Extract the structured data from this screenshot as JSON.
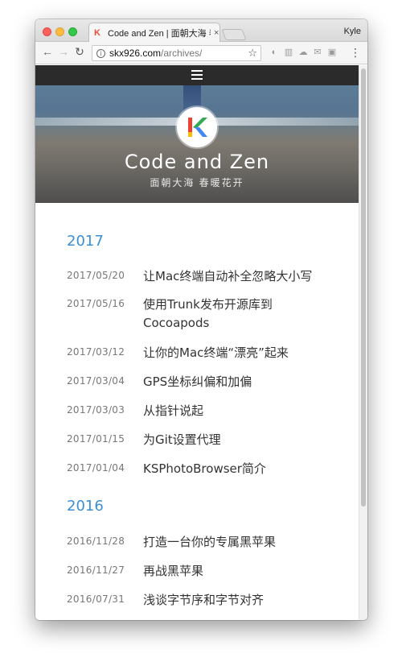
{
  "browser": {
    "tab_title": "Code and Zen | 面朝大海 春暖花开",
    "tab_close": "×",
    "profile_name": "Kyle",
    "url_host": "skx926.com",
    "url_path": "/archives/"
  },
  "site": {
    "title": "Code and Zen",
    "subtitle": "面朝大海 春暖花开",
    "logo_letter": "K"
  },
  "archives": [
    {
      "year": "2017",
      "posts": [
        {
          "date": "2017/05/20",
          "title": "让Mac终端自动补全忽略大小写"
        },
        {
          "date": "2017/05/16",
          "title": "使用Trunk发布开源库到Cocoapods"
        },
        {
          "date": "2017/03/12",
          "title": "让你的Mac终端“漂亮”起来"
        },
        {
          "date": "2017/03/04",
          "title": "GPS坐标纠偏和加偏"
        },
        {
          "date": "2017/03/03",
          "title": "从指针说起"
        },
        {
          "date": "2017/01/15",
          "title": "为Git设置代理"
        },
        {
          "date": "2017/01/04",
          "title": "KSPhotoBrowser简介"
        }
      ]
    },
    {
      "year": "2016",
      "posts": [
        {
          "date": "2016/11/28",
          "title": "打造一台你的专属黑苹果"
        },
        {
          "date": "2016/11/27",
          "title": "再战黑苹果"
        },
        {
          "date": "2016/07/31",
          "title": "浅谈字节序和字节对齐"
        }
      ]
    }
  ],
  "icons": {
    "back": "back-arrow-icon",
    "forward": "forward-arrow-icon",
    "reload": "reload-icon",
    "info": "info-icon",
    "star": "bookmark-star-icon",
    "menu": "hamburger-menu-icon",
    "more": "more-vertical-icon"
  },
  "colors": {
    "year_accent": "#3a8fd6",
    "nav_bg": "#2b2b2b"
  }
}
